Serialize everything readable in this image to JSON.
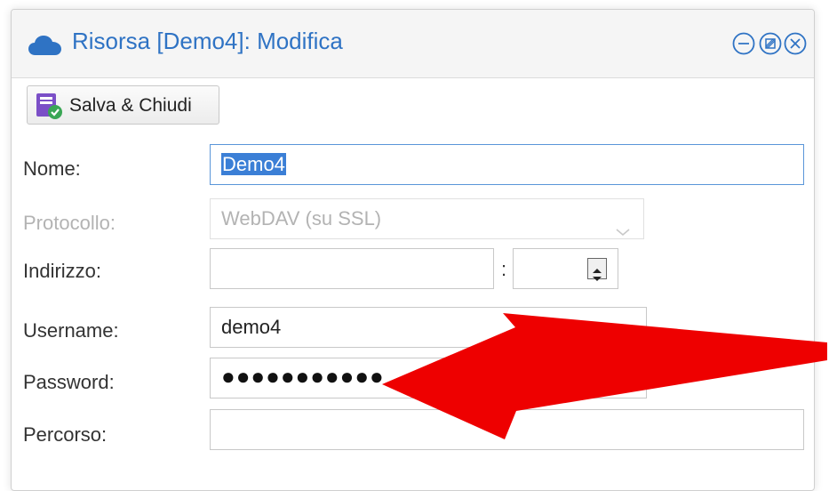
{
  "window": {
    "title": "Risorsa [Demo4]: Modifica",
    "title_icon": "cloud-icon",
    "controls": [
      "minimize-icon",
      "restore-icon",
      "close-icon"
    ],
    "accent_color": "#2f73c4"
  },
  "toolbar": {
    "save_label": "Salva & Chiudi",
    "save_icon": "save-close-icon"
  },
  "form": {
    "nome": {
      "label": "Nome:",
      "value": "Demo4"
    },
    "protocollo": {
      "label": "Protocollo:",
      "value": "WebDAV (su SSL)",
      "disabled": true
    },
    "indirizzo": {
      "label": "Indirizzo:",
      "host": "",
      "separator": ":",
      "port": ""
    },
    "username": {
      "label": "Username:",
      "value": "demo4"
    },
    "password": {
      "label": "Password:",
      "value": "●●●●●●●●●●●"
    },
    "percorso": {
      "label": "Percorso:",
      "value": ""
    }
  },
  "annotation": {
    "type": "arrow",
    "color": "#ee0000",
    "points_to": "password"
  }
}
